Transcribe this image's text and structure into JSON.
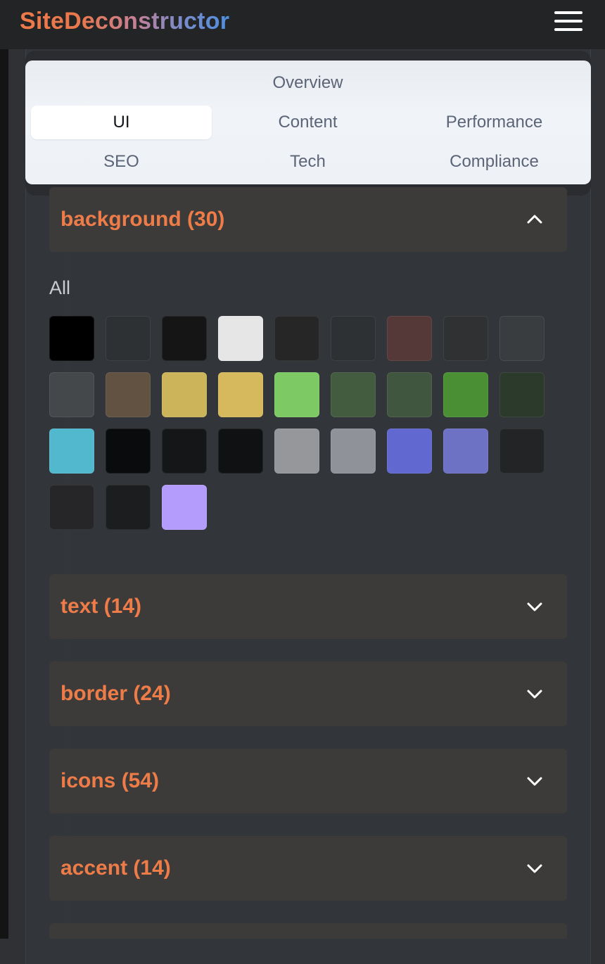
{
  "app": {
    "title_part1": "SiteDeconstructor"
  },
  "nav": {
    "items": [
      {
        "label": "Overview",
        "active": false
      },
      {
        "label": "UI",
        "active": true
      },
      {
        "label": "Content",
        "active": false
      },
      {
        "label": "Performance",
        "active": false
      },
      {
        "label": "SEO",
        "active": false
      },
      {
        "label": "Tech",
        "active": false
      },
      {
        "label": "Compliance",
        "active": false
      }
    ]
  },
  "sections": {
    "background": {
      "title": "background (30)",
      "expanded": true,
      "icon": "chevron-up-icon"
    },
    "text": {
      "title": "text (14)",
      "expanded": false,
      "icon": "chevron-down-icon"
    },
    "border": {
      "title": "border (24)",
      "expanded": false,
      "icon": "chevron-down-icon"
    },
    "icons": {
      "title": "icons (54)",
      "expanded": false,
      "icon": "chevron-down-icon"
    },
    "accent": {
      "title": "accent (14)",
      "expanded": false,
      "icon": "chevron-down-icon"
    }
  },
  "background_filter": {
    "label": "All"
  },
  "background_colors": [
    "#000000",
    "#2d3133",
    "#151515",
    "#e6e6e6",
    "#262626",
    "#2e3133",
    "#553838",
    "#2f3133",
    "#3a3d40",
    "#45484b",
    "#615242",
    "#cbb45a",
    "#d6b95c",
    "#7dca65",
    "#435c40",
    "#41563f",
    "#4a8f33",
    "#2c3a2c",
    "#52b8cd",
    "#0a0b0d",
    "#151617",
    "#0f1113",
    "#96979b",
    "#8f9298",
    "#6168cf",
    "#6d72c4",
    "#232426",
    "#262629",
    "#1c1d1f",
    "#b39cfb"
  ],
  "colors": {
    "accent_orange": "#ee7c48",
    "nav_active_bg": "#ffffff",
    "section_bg": "#3d3b3a"
  }
}
